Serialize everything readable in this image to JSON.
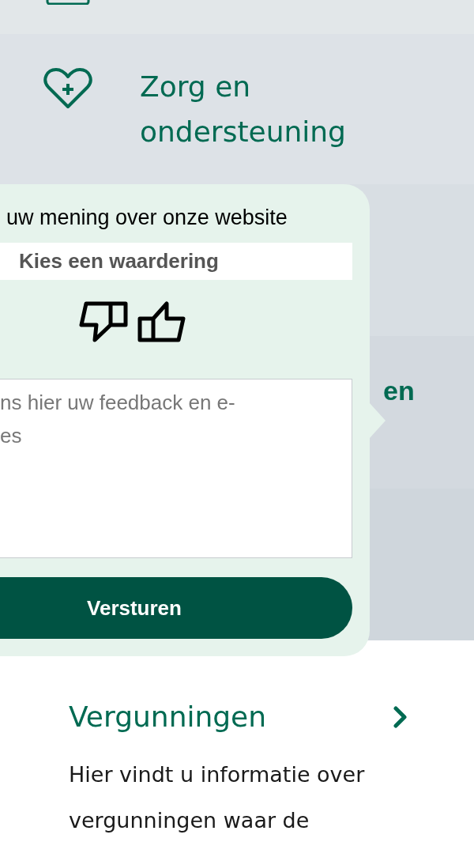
{
  "menu_tiles": [
    {
      "kind": "partial"
    },
    {
      "kind": "health",
      "label": "Zorg en ondersteuning"
    },
    {
      "kind": "hidden"
    },
    {
      "kind": "cut",
      "label": "en"
    },
    {
      "kind": "hidden"
    }
  ],
  "feedback_popup": {
    "heading": "uw mening over onze website",
    "rating_field": {
      "placeholder": "Kies een waardering"
    },
    "feedback_field": {
      "placeholder_lines": [
        "ns hier uw feedback en e-",
        "es"
      ]
    },
    "submit_button": "Versturen"
  },
  "card": {
    "title": "Vergunningen",
    "description": "Hier vindt u informatie over vergunningen waar de"
  }
}
